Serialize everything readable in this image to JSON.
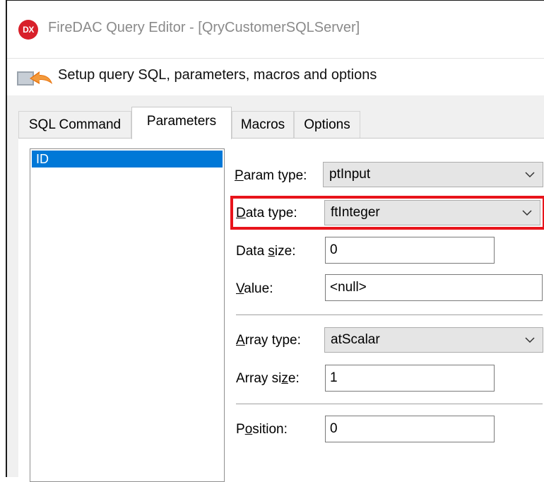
{
  "window": {
    "title": "FireDAC Query Editor - [QryCustomerSQLServer]",
    "logo_text": "DX",
    "logo_icon": "dx-logo-icon"
  },
  "header": {
    "text": "Setup query SQL, parameters, macros and options",
    "icon": "wizard-arrow-icon"
  },
  "tabs": [
    {
      "label": "SQL Command",
      "active": false
    },
    {
      "label": "Parameters",
      "active": true
    },
    {
      "label": "Macros",
      "active": false
    },
    {
      "label": "Options",
      "active": false
    }
  ],
  "params_list": {
    "items": [
      "ID"
    ],
    "selected": "ID"
  },
  "fields": {
    "param_type": {
      "label_pre": "",
      "label_acc": "P",
      "label_post": "aram type:",
      "value": "ptInput"
    },
    "data_type": {
      "label_pre": "",
      "label_acc": "D",
      "label_post": "ata type:",
      "value": "ftInteger"
    },
    "data_size": {
      "label_pre": "Data ",
      "label_acc": "s",
      "label_post": "ize:",
      "value": "0"
    },
    "value": {
      "label_pre": "",
      "label_acc": "V",
      "label_post": "alue:",
      "value": "<null>"
    },
    "array_type": {
      "label_pre": "",
      "label_acc": "A",
      "label_post": "rray type:",
      "value": "atScalar"
    },
    "array_size": {
      "label_pre": "Array si",
      "label_acc": "z",
      "label_post": "e:",
      "value": "1"
    },
    "position": {
      "label_pre": "P",
      "label_acc": "o",
      "label_post": "sition:",
      "value": "0"
    }
  },
  "colors": {
    "highlight": "#e8141b",
    "selection": "#0078d7",
    "logo": "#d8202a"
  }
}
